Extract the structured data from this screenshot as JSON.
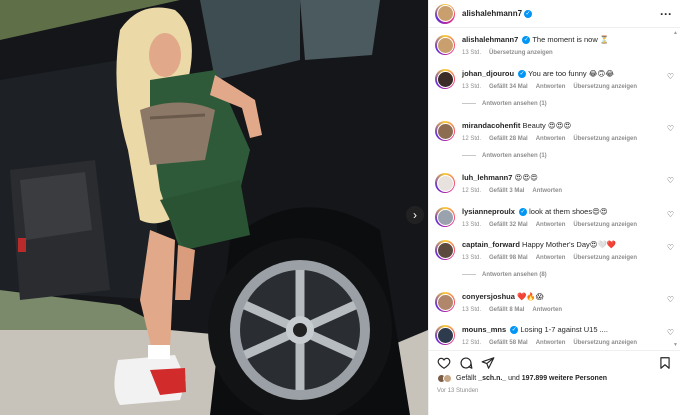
{
  "post": {
    "username": "alishalehmann7",
    "caption": "The moment is now ⏳",
    "caption_time": "13 Std.",
    "caption_translate": "Übersetzung anzeigen"
  },
  "comments": [
    {
      "user": "johan_djourou",
      "verified": true,
      "text": "You are too funny 😂🙃😂",
      "time": "13 Std.",
      "likes": "Gefällt 34 Mal",
      "reply": "Antworten",
      "translate": "Übersetzung anzeigen",
      "replies": "Antworten ansehen (1)"
    },
    {
      "user": "mirandacohenfit",
      "verified": false,
      "text": "Beauty 😍😍😍",
      "time": "12 Std.",
      "likes": "Gefällt 28 Mal",
      "reply": "Antworten",
      "translate": "Übersetzung anzeigen",
      "replies": "Antworten ansehen (1)"
    },
    {
      "user": "luh_lehmann7",
      "verified": false,
      "text": "😍😍😍",
      "time": "12 Std.",
      "likes": "Gefällt 3 Mal",
      "reply": "Antworten",
      "translate": "",
      "replies": ""
    },
    {
      "user": "lysianneproulx",
      "verified": true,
      "text": "look at them shoes😍😍",
      "time": "13 Std.",
      "likes": "Gefällt 32 Mal",
      "reply": "Antworten",
      "translate": "Übersetzung anzeigen",
      "replies": ""
    },
    {
      "user": "captain_forward",
      "verified": false,
      "text": "Happy Mother's Day😍🤍❤️",
      "time": "13 Std.",
      "likes": "Gefällt 98 Mal",
      "reply": "Antworten",
      "translate": "Übersetzung anzeigen",
      "replies": "Antworten ansehen (8)"
    },
    {
      "user": "conyersjoshua",
      "verified": false,
      "text": "❤️🔥😱",
      "time": "13 Std.",
      "likes": "Gefällt 8 Mal",
      "reply": "Antworten",
      "translate": "",
      "replies": ""
    },
    {
      "user": "mouns_mns",
      "verified": true,
      "text": "Losing 1-7 against U15 ....",
      "time": "12 Std.",
      "likes": "Gefällt 58 Mal",
      "reply": "Antworten",
      "translate": "Übersetzung anzeigen",
      "replies": ""
    }
  ],
  "likes": {
    "prefix": "Gefällt ",
    "user": "_sch.n._",
    "middle": " und ",
    "count": "197.899 weitere Personen"
  },
  "timestamp": "Vor 13 Stunden",
  "icons": [
    "more-icon",
    "heart-icon",
    "comment-icon",
    "share-icon",
    "save-icon",
    "chevron-right-icon"
  ]
}
